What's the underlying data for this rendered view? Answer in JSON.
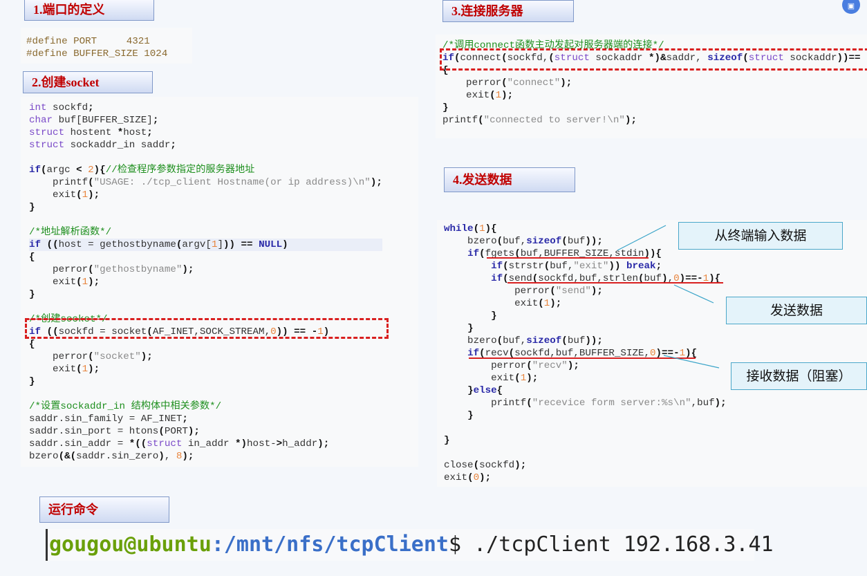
{
  "sections": {
    "s1": "1.端口的定义",
    "s2": "2.创建socket",
    "s3": "3.连接服务器",
    "s4": "4.发送数据",
    "run": "运行命令"
  },
  "annotations": {
    "input": "从终端输入数据",
    "send": "发送数据",
    "recv": "接收数据（阻塞）"
  },
  "terminal": {
    "user": "gougou@ubuntu",
    "path": ":/mnt/nfs/tcpClient",
    "prompt": "$",
    "command": " ./tcpClient 192.168.3.41"
  },
  "code": {
    "port": [
      "#define PORT     4321",
      "#define BUFFER_SIZE 1024"
    ],
    "socket": [
      "int sockfd;",
      "char buf[BUFFER_SIZE];",
      "struct hostent *host;",
      "struct sockaddr_in saddr;",
      "",
      "if(argc < 2){//检查程序参数指定的服务器地址",
      "    printf(\"USAGE: ./tcp_client Hostname(or ip address)\\n\");",
      "    exit(1);",
      "}",
      "",
      "/*地址解析函数*/",
      "if ((host = gethostbyname(argv[1])) == NULL)",
      "{",
      "    perror(\"gethostbyname\");",
      "    exit(1);",
      "}",
      "",
      "/*创建socket*/",
      "if ((sockfd = socket(AF_INET,SOCK_STREAM,0)) == -1)",
      "{",
      "    perror(\"socket\");",
      "    exit(1);",
      "}",
      "",
      "/*设置sockaddr_in 结构体中相关参数*/",
      "saddr.sin_family = AF_INET;",
      "saddr.sin_port = htons(PORT);",
      "saddr.sin_addr = *((struct in_addr *)host->h_addr);",
      "bzero(&(saddr.sin_zero), 8);"
    ],
    "connect": [
      "/*调用connect函数主动发起对服务器端的连接*/",
      "if(connect(sockfd,(struct sockaddr *)&saddr, sizeof(struct sockaddr))==",
      "{",
      "    perror(\"connect\");",
      "    exit(1);",
      "}",
      "printf(\"connected to server!\\n\");"
    ],
    "send": [
      "while(1){",
      "    bzero(buf,sizeof(buf));",
      "    if(fgets(buf,BUFFER_SIZE,stdin)){",
      "        if(strstr(buf,\"exit\")) break;",
      "        if(send(sockfd,buf,strlen(buf),0)==-1){",
      "            perror(\"send\");",
      "            exit(1);",
      "        }",
      "    }",
      "    bzero(buf,sizeof(buf));",
      "    if(recv(sockfd,buf,BUFFER_SIZE,0)==-1){",
      "        perror(\"recv\");",
      "        exit(1);",
      "    }else{",
      "        printf(\"recevice form server:%s\\n\",buf);",
      "    }",
      "",
      "}",
      "",
      "close(sockfd);",
      "exit(0);"
    ]
  }
}
